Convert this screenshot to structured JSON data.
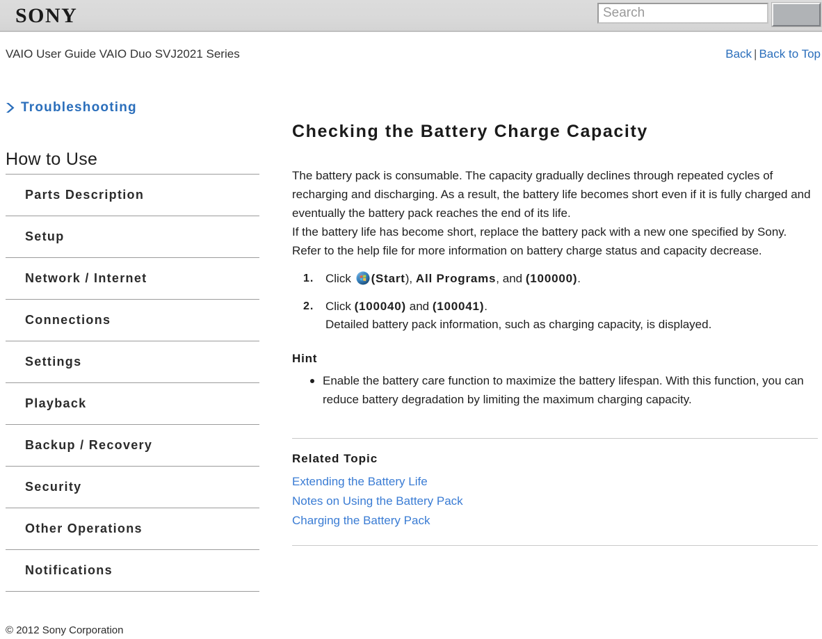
{
  "header": {
    "logo": "SONY",
    "search": {
      "placeholder": "Search",
      "value": "",
      "button_label": ""
    }
  },
  "sub_header": {
    "guide_title": "VAIO User Guide VAIO Duo SVJ2021 Series",
    "nav": {
      "back": "Back",
      "separator": "|",
      "back_to_top": "Back to Top"
    }
  },
  "sidebar": {
    "troubleshooting": "Troubleshooting",
    "section_title": "How to Use",
    "items": [
      {
        "label": "Parts Description"
      },
      {
        "label": "Setup"
      },
      {
        "label": "Network / Internet"
      },
      {
        "label": "Connections"
      },
      {
        "label": "Settings"
      },
      {
        "label": "Playback"
      },
      {
        "label": "Backup / Recovery"
      },
      {
        "label": "Security"
      },
      {
        "label": "Other Operations"
      },
      {
        "label": "Notifications"
      }
    ]
  },
  "main": {
    "heading": "Checking the Battery Charge Capacity",
    "intro_line_1": "The battery pack is consumable. The capacity gradually declines through repeated cycles of recharging and discharging. As a result, the battery life becomes short even if it is fully charged and eventually the battery pack reaches the end of its life.",
    "intro_line_2": "If the battery life has become short, replace the battery pack with a new one specified by Sony. Refer to the help file for more information on battery charge status and capacity decrease.",
    "steps": [
      {
        "prefix": "Click ",
        "start_open": "(",
        "start_label": "Start",
        "start_close": "), ",
        "all_programs": "All Programs",
        "middle": ", and ",
        "item": "(100000)",
        "suffix": "."
      },
      {
        "prefix": "Click ",
        "item1": "(100040)",
        "middle": " and ",
        "item2": "(100041)",
        "suffix": ".",
        "detail": "Detailed battery pack information, such as charging capacity, is displayed."
      }
    ],
    "hint_heading": "Hint",
    "hint_items": [
      "Enable the battery care function to maximize the battery lifespan. With this function, you can reduce battery degradation by limiting the maximum charging capacity."
    ],
    "related_heading": "Related Topic",
    "related_links": [
      {
        "label": "Extending the Battery Life"
      },
      {
        "label": "Notes on Using the Battery Pack"
      },
      {
        "label": "Charging the Battery Pack"
      }
    ]
  },
  "footer": {
    "copyright": "© 2012 Sony Corporation"
  },
  "colors": {
    "link_blue": "#2a6ebb",
    "related_link_blue": "#3a7cd4",
    "header_gray": "#d9d9d9",
    "divider_gray": "#9b9b9b",
    "text": "#1f1f1f"
  },
  "icons": {
    "troubleshooting_chevron": "chevron-right-icon",
    "windows_start": "windows-start-orb-icon",
    "search_button": "search-button-icon"
  }
}
